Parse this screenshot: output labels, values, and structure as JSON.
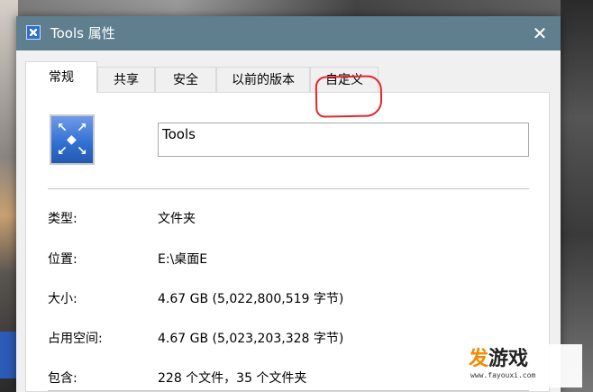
{
  "window": {
    "title": "Tools 属性",
    "close_glyph": "✕"
  },
  "tabs": [
    {
      "label": "常规",
      "active": true
    },
    {
      "label": "共享",
      "active": false
    },
    {
      "label": "安全",
      "active": false
    },
    {
      "label": "以前的版本",
      "active": false
    },
    {
      "label": "自定义",
      "active": false
    }
  ],
  "general": {
    "folder_name": "Tools",
    "properties": [
      {
        "label": "类型:",
        "value": "文件夹"
      },
      {
        "label": "位置:",
        "value": "E:\\桌面E"
      },
      {
        "label": "大小:",
        "value": "4.67 GB (5,022,800,519 字节)"
      },
      {
        "label": "占用空间:",
        "value": "4.67 GB (5,023,203,328 字节)"
      },
      {
        "label": "包含:",
        "value": "228 个文件，35 个文件夹"
      }
    ]
  },
  "icons": {
    "title_icon": "folder-app-icon",
    "folder_icon": "expand-arrows-folder-icon",
    "close_icon": "close-icon"
  },
  "watermark": {
    "logo_first": "发",
    "logo_rest": "游戏",
    "url": "www.fayouxi.com"
  },
  "colors": {
    "titlebar": "#5f7f8e",
    "annotation": "#e0262b",
    "watermark_orange": "#f08a00"
  }
}
